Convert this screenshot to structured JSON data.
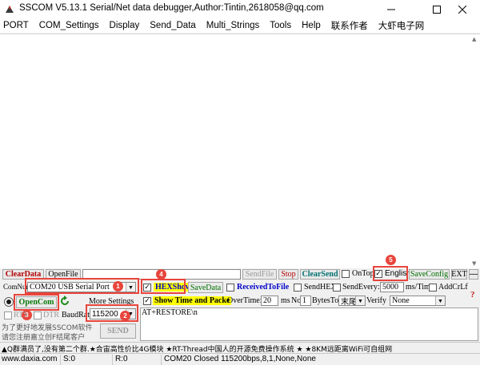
{
  "window": {
    "title": "SSCOM V5.13.1 Serial/Net data debugger,Author:Tintin,2618058@qq.com",
    "minimize_icon": "minimize-icon",
    "maximize_icon": "maximize-icon",
    "close_icon": "close-icon"
  },
  "menu": [
    "PORT",
    "COM_Settings",
    "Display",
    "Send_Data",
    "Multi_Strings",
    "Tools",
    "Help",
    "联系作者",
    "大虾电子网"
  ],
  "toolbar1": {
    "clear_data": "ClearData",
    "open_file": "OpenFile",
    "file_path": "",
    "send_file": "SendFile",
    "stop": "Stop",
    "clear_send": "ClearSend",
    "on_top_label": "OnTop",
    "on_top_checked": false,
    "english_label": "English",
    "english_checked": true,
    "save_config": "SaveConfig",
    "ext": "EXT",
    "collapse": "—"
  },
  "port_row": {
    "com_num_label": "ComNum",
    "com_port": "COM20 USB Serial Port",
    "hex_show_label": "HEXShow",
    "hex_show_checked": true,
    "save_data": "SaveData",
    "received_to_file_label": "ReceivedToFile",
    "received_to_file_checked": false,
    "send_hex_label": "SendHEX",
    "send_hex_checked": false,
    "send_every_label": "SendEvery:",
    "send_every_checked": false,
    "send_every_value": "5000",
    "ms_tim_label": "ms/Tim",
    "add_crlf_label": "AddCrLf",
    "add_crlf_checked": false
  },
  "open_row": {
    "open_com": "OpenCom",
    "more_settings": "More Settings",
    "show_time_label": "Show Time and Packe",
    "show_time_checked": true,
    "overtime_label": "OverTime:",
    "overtime_value": "20",
    "ms_label": "ms",
    "no_label": "No",
    "no_value": "1",
    "bytes_to_label": "BytesTo",
    "bytes_to_value": "末尾",
    "verify_label": "Verify",
    "verify_value": "None"
  },
  "send_area": {
    "text": "AT+RESTORE\\n",
    "rts_label": "RTS",
    "dtr_label": "DTR",
    "baud_label": "BaudRate:",
    "baud_value": "115200",
    "send_button": "SEND"
  },
  "promo": {
    "line1": "为了更好地发展SSCOM软件",
    "line2": "请您注册嘉立创F结尾客户"
  },
  "ticker": "▲Q群满员了,没有第二个群.★合宙高性价比4G模块 ★RT-Thread中国人的开源免费操作系统 ★ ★8KM远距离WiFi可自组网",
  "statusbar": {
    "site": "www.daxia.com",
    "s_count": "S:0",
    "r_count": "R:0",
    "port_state": "COM20 Closed  115200bps,8,1,None,None"
  },
  "markers": [
    "1",
    "2",
    "3",
    "4",
    "5"
  ],
  "colors": {
    "annotation_red": "#e8453c",
    "clear_data_red": "#b00000",
    "save_green": "#006e00",
    "highlight_yellow": "#ffff00"
  }
}
